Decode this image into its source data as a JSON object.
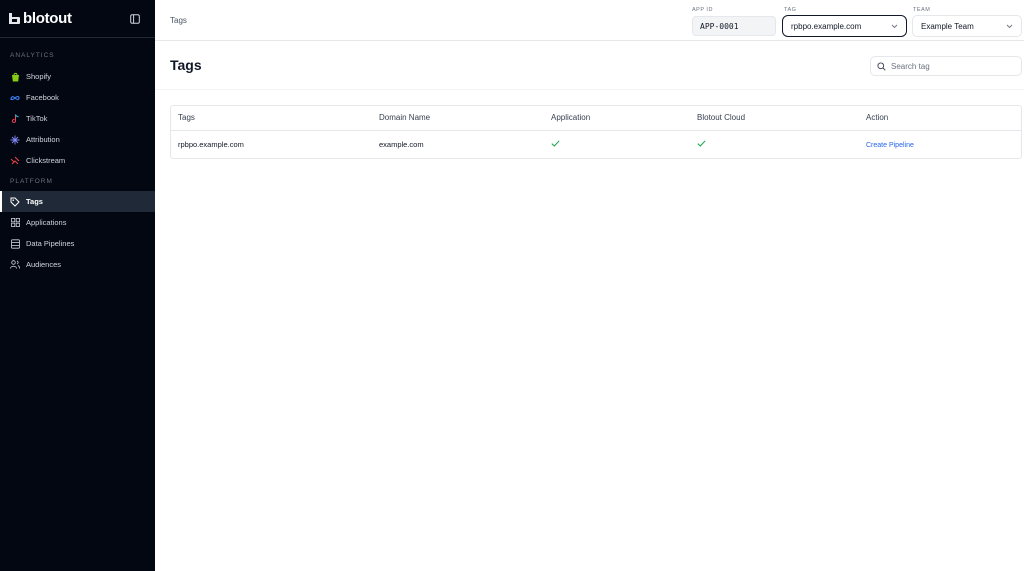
{
  "brand": {
    "name": "blotout"
  },
  "sidebar": {
    "sections": [
      {
        "label": "ANALYTICS",
        "items": [
          {
            "label": "Shopify",
            "icon": "shopify-icon"
          },
          {
            "label": "Facebook",
            "icon": "facebook-icon"
          },
          {
            "label": "TikTok",
            "icon": "tiktok-icon"
          },
          {
            "label": "Attribution",
            "icon": "attribution-icon"
          },
          {
            "label": "Clickstream",
            "icon": "clickstream-icon"
          }
        ]
      },
      {
        "label": "PLATFORM",
        "items": [
          {
            "label": "Tags",
            "icon": "tag-icon",
            "active": true
          },
          {
            "label": "Applications",
            "icon": "grid-icon"
          },
          {
            "label": "Data Pipelines",
            "icon": "database-icon"
          },
          {
            "label": "Audiences",
            "icon": "users-icon"
          }
        ]
      }
    ]
  },
  "topbar": {
    "breadcrumb": "Tags",
    "app_id": {
      "label": "APP ID",
      "value": "APP-0001"
    },
    "tag": {
      "label": "TAG",
      "value": "rpbpo.example.com"
    },
    "team": {
      "label": "TEAM",
      "value": "Example Team"
    }
  },
  "page": {
    "title": "Tags",
    "search_placeholder": "Search tag"
  },
  "table": {
    "columns": [
      "Tags",
      "Domain Name",
      "Application",
      "Blotout Cloud",
      "Action"
    ],
    "rows": [
      {
        "tag": "rpbpo.example.com",
        "domain": "example.com",
        "application": true,
        "cloud": true,
        "action": "Create Pipeline"
      }
    ]
  },
  "colors": {
    "sidebar_bg": "#030712",
    "accent": "#2563eb",
    "check": "#16a34a"
  }
}
